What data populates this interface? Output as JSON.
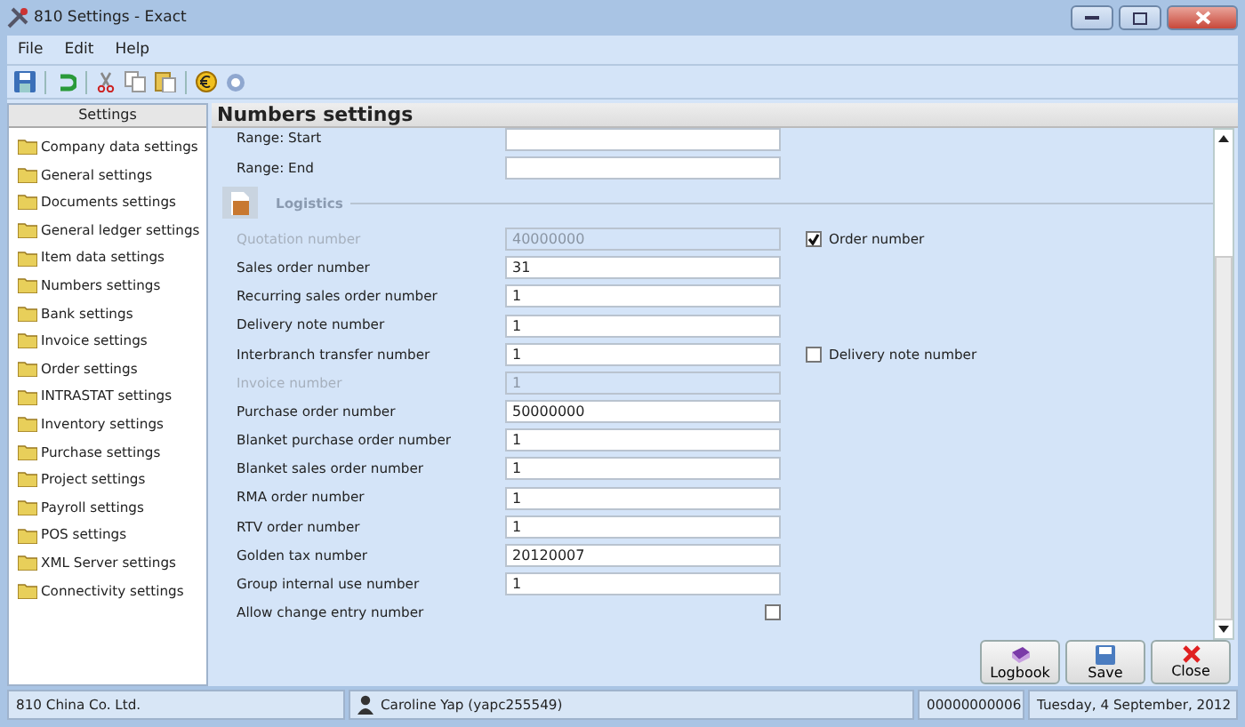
{
  "window": {
    "title": "810 Settings - Exact"
  },
  "menu": [
    "File",
    "Edit",
    "Help"
  ],
  "sidebar": {
    "title": "Settings",
    "items": [
      "Company data settings",
      "General settings",
      "Documents settings",
      "General ledger settings",
      "Item data settings",
      "Numbers settings",
      "Bank settings",
      "Invoice settings",
      "Order settings",
      "INTRASTAT settings",
      "Inventory settings",
      "Purchase settings",
      "Project settings",
      "Payroll settings",
      "POS settings",
      "XML Server settings",
      "Connectivity settings"
    ]
  },
  "panel": {
    "title": "Numbers settings",
    "range_rows": [
      {
        "label": "Range: Start",
        "value": ""
      },
      {
        "label": "Range: End",
        "value": ""
      }
    ],
    "group": "Logistics",
    "rows": [
      {
        "kind": "text",
        "label": "Quotation number",
        "value": "40000000",
        "disabled": true,
        "option": {
          "label": "Order number",
          "checked": true
        }
      },
      {
        "kind": "text",
        "label": "Sales order number",
        "value": "31",
        "disabled": false
      },
      {
        "kind": "text",
        "label": "Recurring sales order number",
        "value": "1",
        "disabled": false
      },
      {
        "kind": "text",
        "label": "Delivery note number",
        "value": "1",
        "disabled": false
      },
      {
        "kind": "text",
        "label": "Interbranch transfer number",
        "value": "1",
        "disabled": false,
        "option": {
          "label": "Delivery note number",
          "checked": false
        }
      },
      {
        "kind": "text",
        "label": "Invoice number",
        "value": "1",
        "disabled": true
      },
      {
        "kind": "text",
        "label": "Purchase order number",
        "value": "50000000",
        "disabled": false
      },
      {
        "kind": "text",
        "label": "Blanket purchase order number",
        "value": "1",
        "disabled": false
      },
      {
        "kind": "text",
        "label": "Blanket sales order number",
        "value": "1",
        "disabled": false
      },
      {
        "kind": "text",
        "label": "RMA order number",
        "value": "1",
        "disabled": false
      },
      {
        "kind": "text",
        "label": "RTV order number",
        "value": "1",
        "disabled": false
      },
      {
        "kind": "text",
        "label": "Golden tax number",
        "value": "20120007",
        "disabled": false
      },
      {
        "kind": "text",
        "label": "Group internal use number",
        "value": "1",
        "disabled": false
      },
      {
        "kind": "checkbox",
        "label": "Allow change entry number",
        "checked": false
      }
    ]
  },
  "buttons": [
    {
      "kind": "logbook",
      "label": "Logbook"
    },
    {
      "kind": "save",
      "label": "Save"
    },
    {
      "kind": "close",
      "label": "Close"
    }
  ],
  "status_bar": {
    "company": "810 China Co. Ltd.",
    "user": "Caroline Yap (yapc255549)",
    "number": "00000000006",
    "date": "Tuesday, 4 September, 2012"
  }
}
